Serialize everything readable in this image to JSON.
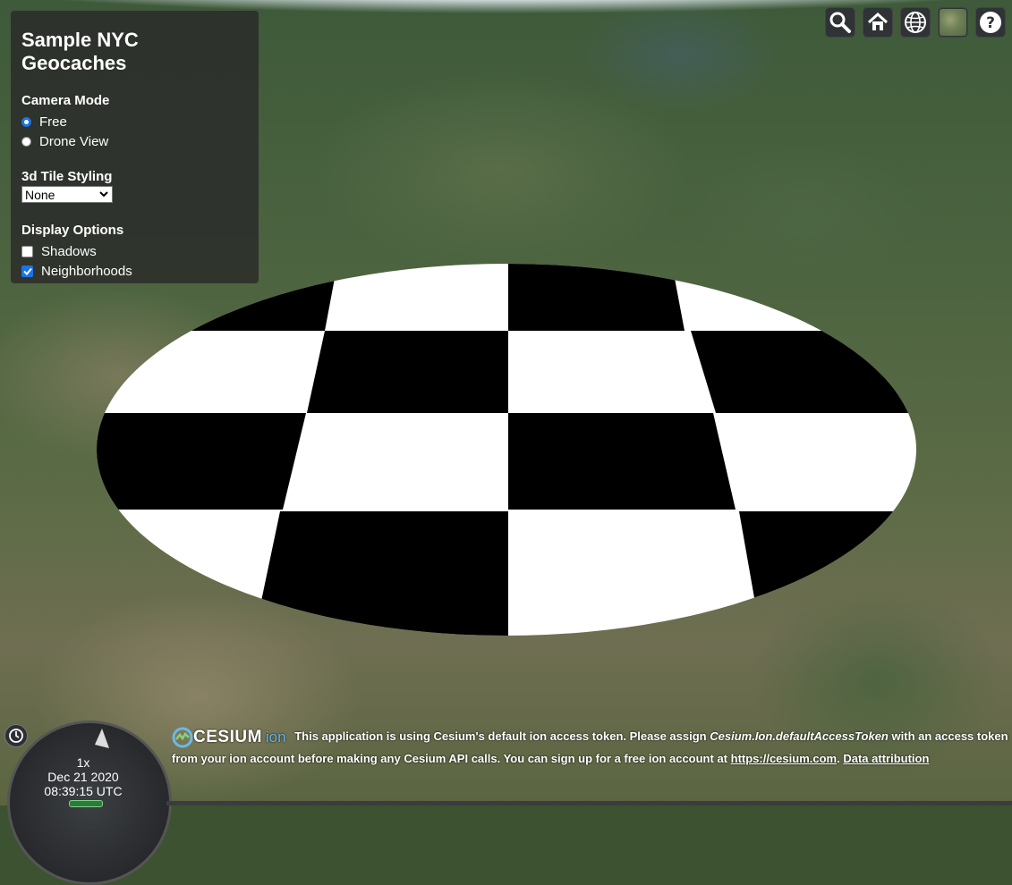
{
  "toolbar": {
    "title": "Sample NYC Geocaches",
    "camera_mode": {
      "label": "Camera Mode",
      "options": [
        {
          "label": "Free",
          "selected": true
        },
        {
          "label": "Drone View",
          "selected": false
        }
      ]
    },
    "tile_styling": {
      "label": "3d Tile Styling",
      "selected": "None"
    },
    "display_options": {
      "label": "Display Options",
      "items": [
        {
          "label": "Shadows",
          "checked": false
        },
        {
          "label": "Neighborhoods",
          "checked": true
        }
      ]
    }
  },
  "top_buttons": [
    {
      "icon": "search-icon"
    },
    {
      "icon": "home-icon"
    },
    {
      "icon": "globe-icon"
    },
    {
      "icon": "imagery-layer-icon"
    },
    {
      "icon": "help-icon"
    }
  ],
  "animation": {
    "speed": "1x",
    "date": "Dec 21 2020",
    "time": "08:39:15 UTC"
  },
  "credits": {
    "logo_main": "CESIUM",
    "logo_sub": "ion",
    "text_before_token": "This application is using Cesium's default ion access token. Please assign",
    "token": "Cesium.Ion.defaultAccessToken",
    "text_after_token": "with an access token from your ion account before making any Cesium API calls. You can sign up for a free ion account at",
    "link": "https://cesium.com",
    "period": ".",
    "attribution": "Data attribution"
  },
  "colors": {
    "panel_bg": "#2a2a2a",
    "accent": "#1a73e8",
    "ion_blue": "#68b4e0"
  }
}
